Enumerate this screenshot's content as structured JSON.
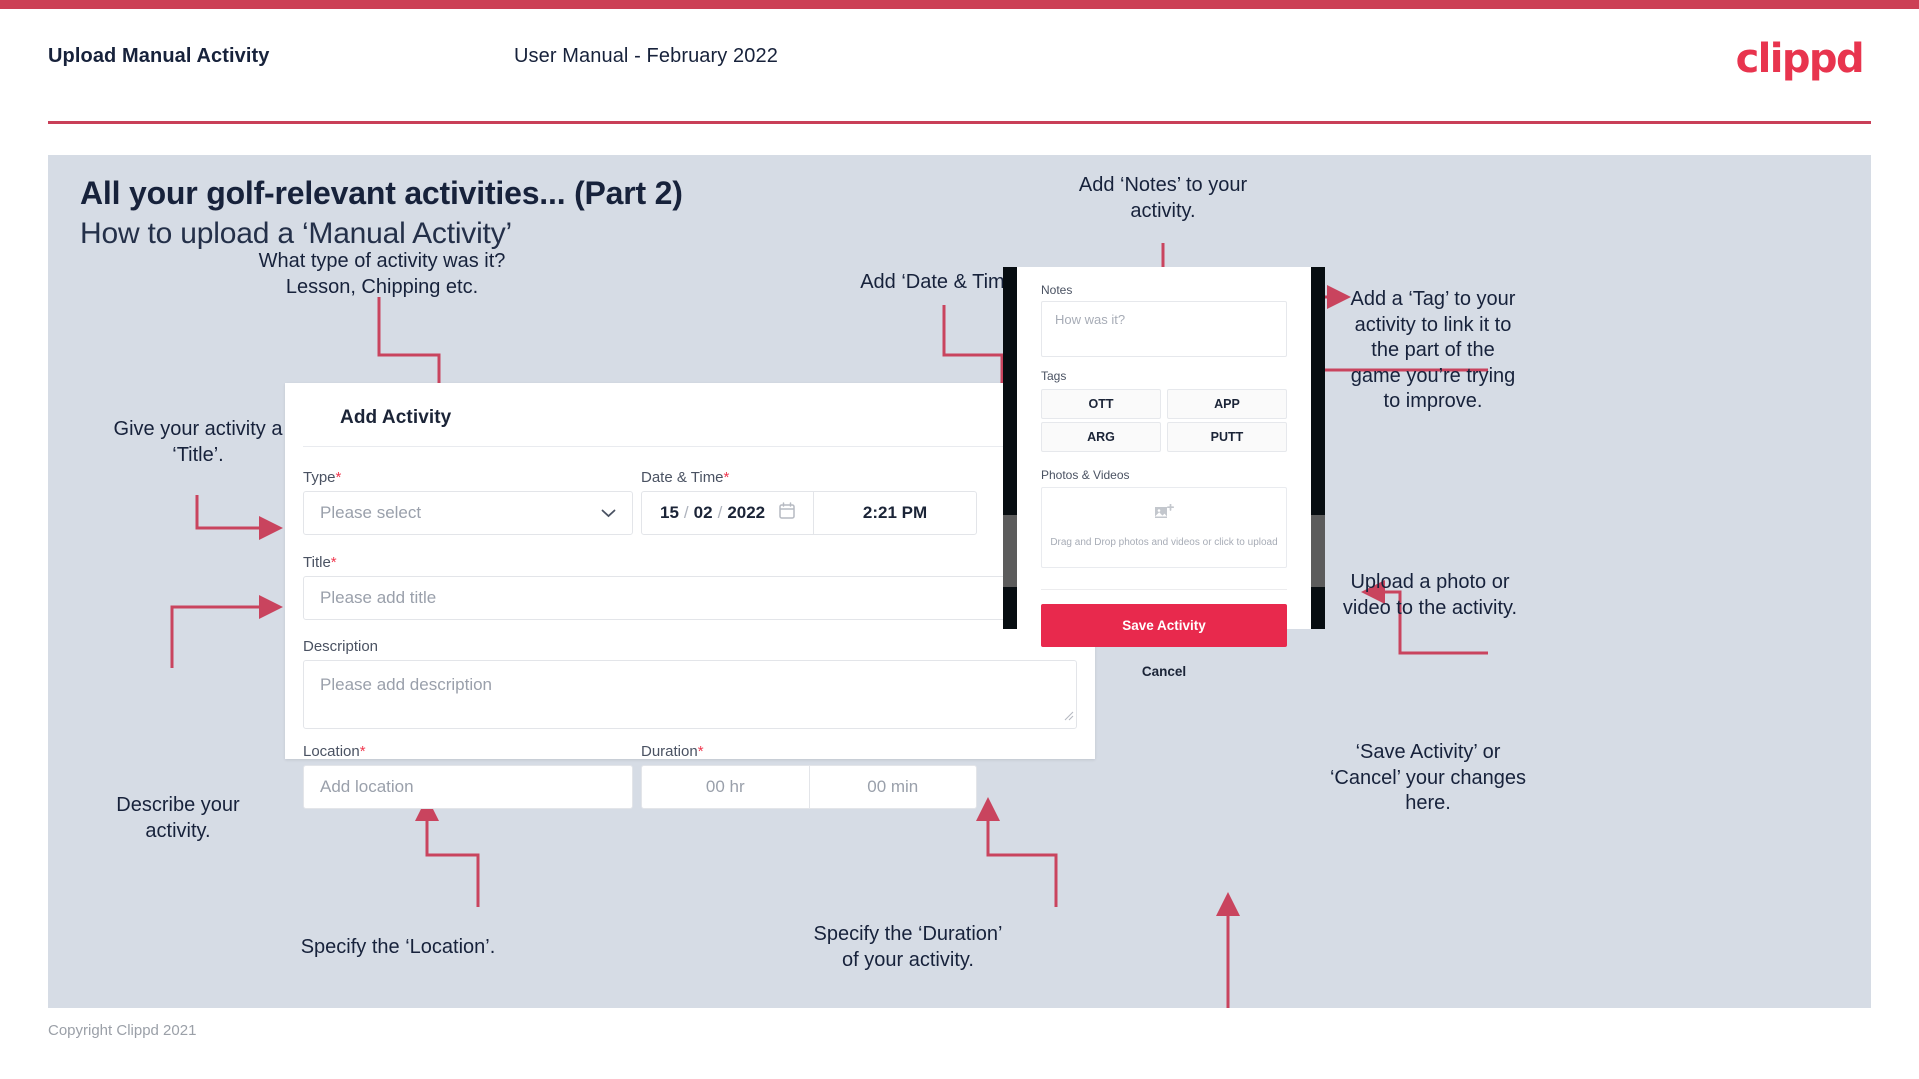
{
  "header": {
    "title": "Upload Manual Activity",
    "subtitle": "User Manual - February 2022",
    "logo": "clippd"
  },
  "slide": {
    "title": "All your golf-relevant activities... (Part 2)",
    "subtitle": "How to upload a ‘Manual Activity’"
  },
  "notes": {
    "type": "What type of activity was it?\nLesson, Chipping etc.",
    "datetime": "Add ‘Date & Time’.",
    "title": "Give your activity a\n‘Title’.",
    "description": "Describe your\nactivity.",
    "location": "Specify the ‘Location’.",
    "duration": "Specify the ‘Duration’\nof your activity.",
    "notes_field": "Add ‘Notes’ to your\nactivity.",
    "tags": "Add a ‘Tag’ to your\nactivity to link it to\nthe part of the\ngame you’re trying\nto improve.",
    "upload": "Upload a photo or\nvideo to the activity.",
    "save_cancel": "‘Save Activity’ or\n‘Cancel’ your changes\nhere."
  },
  "dialog": {
    "title": "Add Activity",
    "close_icon": "close-icon",
    "fields": {
      "type": {
        "label": "Type",
        "required": "*",
        "placeholder": "Please select",
        "caret_icon": "chevron-down-icon"
      },
      "datetime": {
        "label": "Date & Time",
        "required": "*",
        "day": "15",
        "month": "02",
        "year": "2022",
        "sep": "/",
        "calendar_icon": "calendar-icon",
        "time": "2:21 PM"
      },
      "title": {
        "label": "Title",
        "required": "*",
        "placeholder": "Please add title"
      },
      "description": {
        "label": "Description",
        "required": "",
        "placeholder": "Please add description"
      },
      "location": {
        "label": "Location",
        "required": "*",
        "placeholder": "Add location"
      },
      "duration": {
        "label": "Duration",
        "required": "*",
        "hours_placeholder": "00 hr",
        "minutes_placeholder": "00 min"
      }
    }
  },
  "phone": {
    "notes": {
      "label": "Notes",
      "placeholder": "How was it?"
    },
    "tags": {
      "label": "Tags",
      "items": [
        "OTT",
        "APP",
        "ARG",
        "PUTT"
      ]
    },
    "media": {
      "label": "Photos & Videos",
      "icon": "add-image-icon",
      "hint": "Drag and Drop photos and videos or click to upload"
    },
    "save_label": "Save Activity",
    "cancel_label": "Cancel"
  },
  "footer": {
    "copyright": "Copyright Clippd 2021"
  },
  "colors": {
    "accent": "#e8294d",
    "accent_bar": "#cc4055",
    "annotation_line": "#c9445e",
    "panel_bg": "#d6dce5",
    "text_dark": "#17223b"
  }
}
